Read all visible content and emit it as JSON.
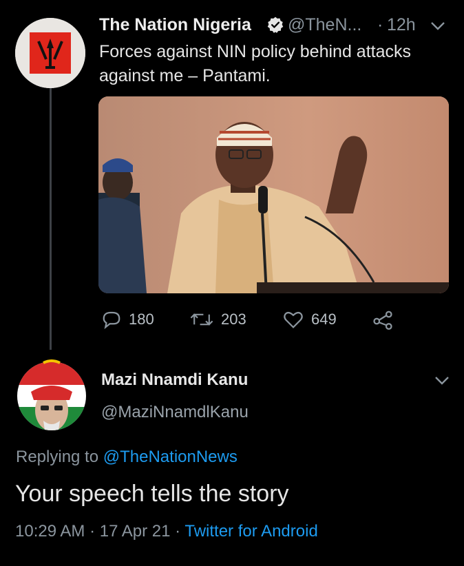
{
  "tweet": {
    "author_name": "The Nation Nigeria",
    "handle": "@TheN...",
    "dot": "·",
    "time": "12h",
    "text": "Forces against NIN policy behind attacks against me – Pantami.",
    "stats": {
      "replies": "180",
      "retweets": "203",
      "likes": "649"
    }
  },
  "reply": {
    "author_name": "Mazi Nnamdi Kanu",
    "handle": "@MaziNnamdlKanu",
    "replying_prefix": "Replying to ",
    "replying_to": "@TheNationNews",
    "text": "Your speech tells the story",
    "timestamp": "10:29 AM · 17 Apr 21 · ",
    "source": "Twitter for Android"
  },
  "colors": {
    "background": "#000000",
    "link": "#1d9bf0",
    "muted": "#8b959e",
    "thread_line": "#3d4146"
  },
  "icons": [
    "verified-badge-icon",
    "chevron-down-icon",
    "reply-icon",
    "retweet-icon",
    "like-icon",
    "share-icon"
  ]
}
